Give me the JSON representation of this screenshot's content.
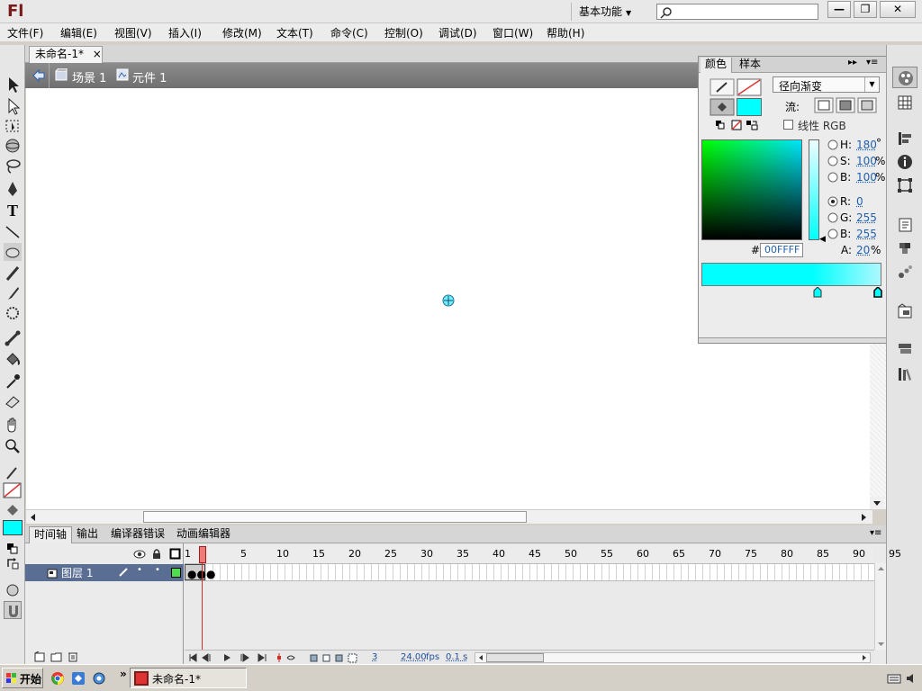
{
  "app": {
    "logo": "Fl",
    "workspace": "基本功能",
    "search_placeholder": ""
  },
  "window_buttons": {
    "minimize": "—",
    "restore": "❐",
    "close": "✕"
  },
  "menu": [
    "文件(F)",
    "编辑(E)",
    "视图(V)",
    "插入(I)",
    "修改(M)",
    "文本(T)",
    "命令(C)",
    "控制(O)",
    "调试(D)",
    "窗口(W)",
    "帮助(H)"
  ],
  "document": {
    "tab_title": "未命名-1*",
    "close": "×"
  },
  "editbar": {
    "scene": "场景 1",
    "symbol": "元件 1"
  },
  "color_panel": {
    "tabs": [
      "颜色",
      "样本"
    ],
    "fill_type": "径向渐变",
    "flow_label": "流:",
    "linear_rgb_label": "线性 RGB",
    "hsb": {
      "H": "180",
      "S": "100",
      "B": "100"
    },
    "hsb_units": {
      "H": "°",
      "S": "%",
      "B": "%"
    },
    "rgb": {
      "R": "0",
      "G": "255",
      "B": "255"
    },
    "alpha": "20",
    "alpha_label": "A:",
    "alpha_unit": "%",
    "hex_label": "#",
    "hex": "00FFFF",
    "selected_color": "#00ffff"
  },
  "timeline": {
    "tabs": [
      "时间轴",
      "输出",
      "编译器错误",
      "动画编辑器"
    ],
    "layer_name": "图层 1",
    "frame_first": "1",
    "frame_numbers": [
      "5",
      "10",
      "15",
      "20",
      "25",
      "30",
      "35",
      "40",
      "45",
      "50",
      "55",
      "60",
      "65",
      "70",
      "75",
      "80",
      "85",
      "90",
      "95"
    ],
    "current_frame": "3",
    "fps": "24.00",
    "fps_unit": "fps",
    "time": "0.1 s"
  },
  "taskbar": {
    "start": "开始",
    "window": "未命名-1*",
    "more": "»"
  },
  "colors": {
    "accent_cyan": "#00ffff",
    "layer_selected": "#5a6e94",
    "playhead": "#d12a2a"
  }
}
